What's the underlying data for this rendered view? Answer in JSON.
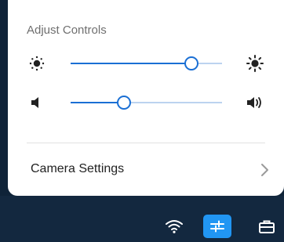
{
  "panel": {
    "title": "Adjust Controls",
    "sliders": [
      {
        "name": "brightness",
        "value": 0.8
      },
      {
        "name": "volume",
        "value": 0.35
      }
    ],
    "camera_settings_label": "Camera Settings"
  },
  "taskbar": {
    "icons": [
      "wifi-icon",
      "quick-controls-icon",
      "briefcase-icon"
    ],
    "active_icon": "quick-controls-icon"
  },
  "colors": {
    "accent": "#1a6fd4",
    "track": "#bcd3ef",
    "active_tray": "#2196f3",
    "taskbar": "#13283f",
    "panel": "#ffffff"
  }
}
